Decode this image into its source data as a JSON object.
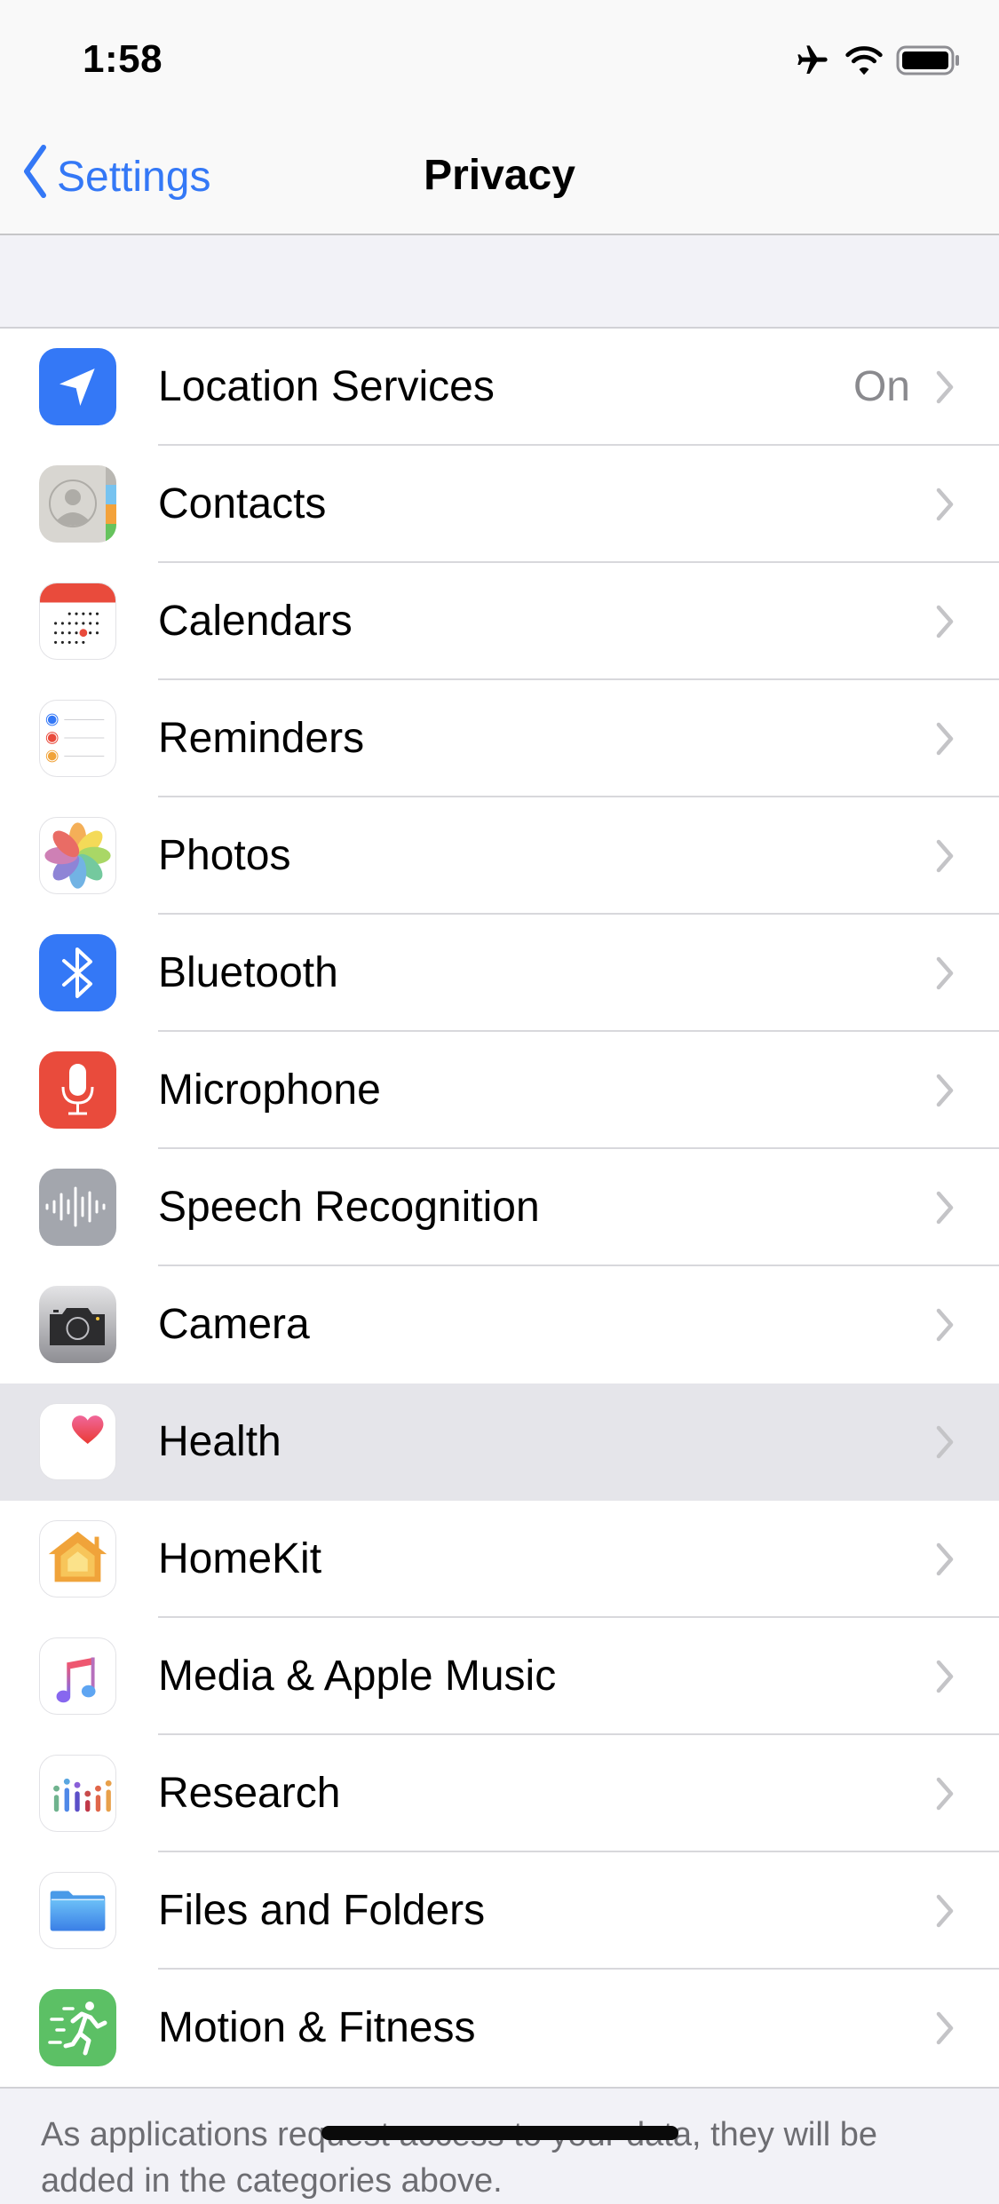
{
  "status_bar": {
    "time": "1:58",
    "icons": [
      "airplane-icon",
      "wifi-icon",
      "battery-icon"
    ]
  },
  "nav": {
    "back_label": "Settings",
    "title": "Privacy"
  },
  "list": {
    "items": [
      {
        "label": "Location Services",
        "value": "On",
        "icon": "location-arrow-icon",
        "color": "#3478f6"
      },
      {
        "label": "Contacts",
        "value": "",
        "icon": "contacts-icon",
        "color": "#d8d6d1"
      },
      {
        "label": "Calendars",
        "value": "",
        "icon": "calendar-icon",
        "color": "#e94b3c"
      },
      {
        "label": "Reminders",
        "value": "",
        "icon": "reminders-icon",
        "color": "#ffffff"
      },
      {
        "label": "Photos",
        "value": "",
        "icon": "photos-icon",
        "color": "#ffffff"
      },
      {
        "label": "Bluetooth",
        "value": "",
        "icon": "bluetooth-icon",
        "color": "#3478f6"
      },
      {
        "label": "Microphone",
        "value": "",
        "icon": "microphone-icon",
        "color": "#e94b3c"
      },
      {
        "label": "Speech Recognition",
        "value": "",
        "icon": "waveform-icon",
        "color": "#a3a6ad"
      },
      {
        "label": "Camera",
        "value": "",
        "icon": "camera-icon",
        "color": "#8e8e93"
      },
      {
        "label": "Health",
        "value": "",
        "icon": "heart-icon",
        "color": "#ffffff",
        "highlighted": true
      },
      {
        "label": "HomeKit",
        "value": "",
        "icon": "home-icon",
        "color": "#ffffff"
      },
      {
        "label": "Media & Apple Music",
        "value": "",
        "icon": "music-note-icon",
        "color": "#ffffff"
      },
      {
        "label": "Research",
        "value": "",
        "icon": "research-icon",
        "color": "#ffffff"
      },
      {
        "label": "Files and Folders",
        "value": "",
        "icon": "folder-icon",
        "color": "#ffffff"
      },
      {
        "label": "Motion & Fitness",
        "value": "",
        "icon": "running-figure-icon",
        "color": "#5cc065"
      }
    ]
  },
  "footer": {
    "text": "As applications request access to your data, they will be added in the categories above."
  },
  "colors": {
    "accent": "#3478f6",
    "highlight_row": "#e5e5ea",
    "secondary_text": "#8a8a8e"
  }
}
